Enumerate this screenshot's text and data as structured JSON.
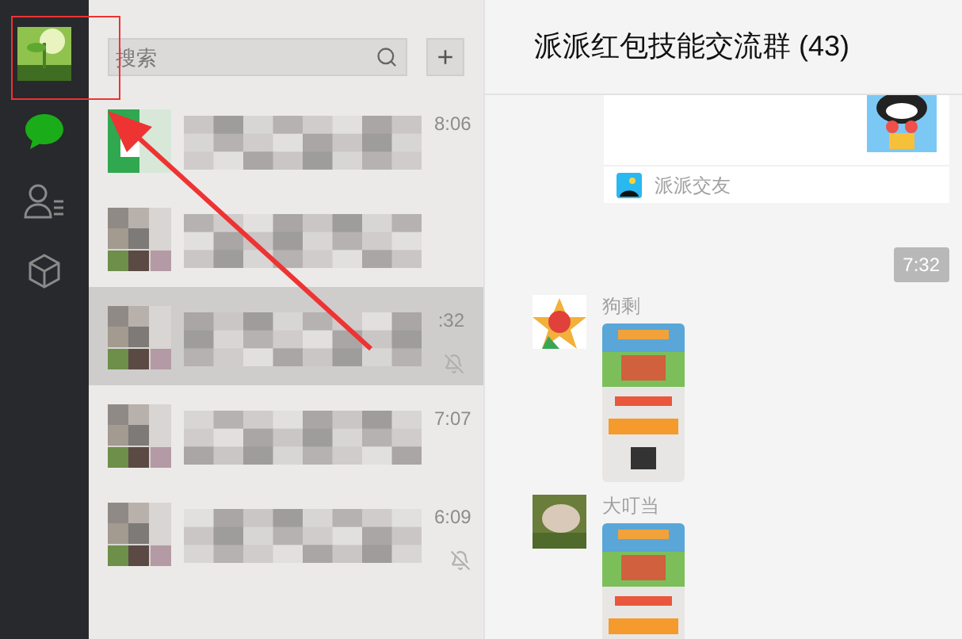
{
  "search": {
    "placeholder": "搜索"
  },
  "add_button": "+",
  "chats": [
    {
      "time": "8:06",
      "muted": false,
      "selected": false,
      "kind": "app"
    },
    {
      "muted": false,
      "selected": false,
      "kind": "group"
    },
    {
      "time": ":32",
      "muted": true,
      "selected": true,
      "kind": "group"
    },
    {
      "time": "7:07",
      "muted": false,
      "selected": false,
      "kind": "group"
    },
    {
      "time": "6:09",
      "muted": true,
      "selected": false,
      "kind": "group"
    }
  ],
  "chat": {
    "title": "派派红包技能交流群 (43)",
    "card": {
      "source": "派派交友"
    },
    "time": "7:32",
    "messages": [
      {
        "sender": "狗剩"
      },
      {
        "sender": "大叮当"
      }
    ]
  }
}
